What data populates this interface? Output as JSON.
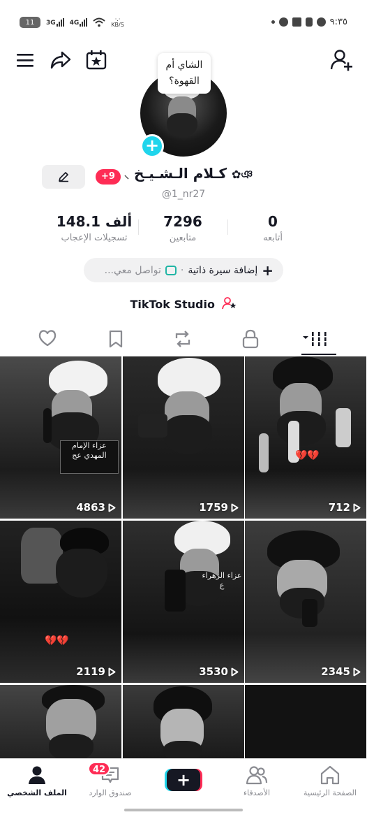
{
  "status_bar": {
    "battery": "11",
    "net1": "3G",
    "net2": "4G",
    "speed": "KB/S",
    "time": "٩:٣٥"
  },
  "profile": {
    "bubble_text": "الشاي أم القهوة؟",
    "display_name": "كـلام الـشـيـخ",
    "name_decoration": "✿ঞ",
    "handle": "@1_nr27",
    "badge": "+9",
    "avatar_add_label": "+"
  },
  "stats": {
    "likes": {
      "value": "148.1 ألف",
      "label": "تسجيلات الإعجاب"
    },
    "followers": {
      "value": "7296",
      "label": "متابعين"
    },
    "following": {
      "value": "0",
      "label": "أتابعه"
    }
  },
  "bio_button": {
    "add_bio": "إضافة سيرة ذاتية",
    "separator": "·",
    "contact": "تواصل معي...",
    "plus": "+"
  },
  "studio": {
    "label": "TikTok Studio",
    "icon": "person-star-icon"
  },
  "tabs": [
    {
      "id": "videos",
      "icon": "grid-icon",
      "active": true
    },
    {
      "id": "private",
      "icon": "lock-icon"
    },
    {
      "id": "reposts",
      "icon": "repost-icon"
    },
    {
      "id": "favorites",
      "icon": "bookmark-icon"
    },
    {
      "id": "liked",
      "icon": "heart-icon"
    }
  ],
  "videos": [
    {
      "views": "712",
      "hearts": "💔💔"
    },
    {
      "views": "1759"
    },
    {
      "views": "4863",
      "caption": "عزاء الإمام المهدي عج"
    },
    {
      "views": "2345"
    },
    {
      "views": "3530",
      "caption": "عزاء الزهراء ع"
    },
    {
      "views": "2119",
      "hearts": "💔💔"
    },
    {
      "views": ""
    },
    {
      "views": ""
    },
    {
      "views": ""
    }
  ],
  "nav": {
    "home": "الصفحة الرئيسية",
    "friends": "الأصدقاء",
    "create": "+",
    "inbox": "صندوق الوارد",
    "inbox_badge": "42",
    "profile": "الملف الشخصي"
  },
  "colors": {
    "accent_red": "#fe2c55",
    "accent_cyan": "#20d5ec",
    "text_primary": "#161823",
    "text_secondary": "#8a8b91"
  }
}
